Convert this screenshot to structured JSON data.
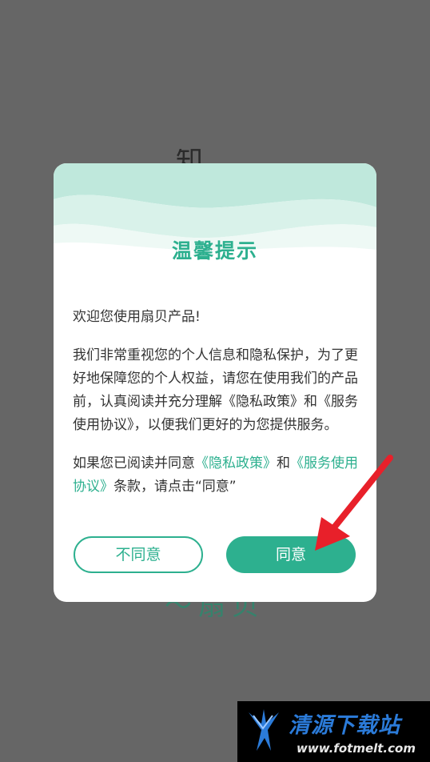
{
  "dialog": {
    "title": "温馨提示",
    "welcome": "欢迎您使用扇贝产品!",
    "body_text": "我们非常重视您的个人信息和隐私保护，为了更好地保障您的个人权益，请您在使用我们的产品前，认真阅读并充分理解《隐私政策》和《服务使用协议》，以便我们更好的为您提供服务。",
    "consent": {
      "prefix": "如果您已阅读并同意",
      "privacy_link": "《隐私政策》",
      "and": "和",
      "service_link": "《服务使用协议》",
      "suffix": "条款，请点击“同意”"
    },
    "disagree_label": "不同意",
    "agree_label": "同意"
  },
  "watermark": {
    "name": "清源下载站",
    "url": "www.fotmelt.com"
  },
  "colors": {
    "accent": "#2db08f",
    "overlay": "#666666",
    "annotation_arrow": "#e8202a"
  },
  "icons": [
    "annotation-arrow-icon",
    "watermark-logo-icon"
  ]
}
